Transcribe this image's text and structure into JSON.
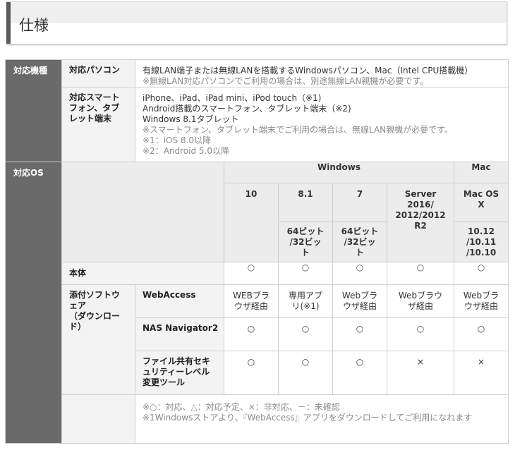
{
  "heading": {
    "title": "仕様"
  },
  "rows": {
    "models": {
      "category": "対応機種",
      "pc": {
        "label": "対応パソコン",
        "text": "有線LAN端子または無線LANを搭載するWindowsパソコン、Mac（Intel CPU搭載機）",
        "note": "※無線LAN対応パソコンでご利用の場合は、別途無線LAN親機が必要です。"
      },
      "mobile": {
        "label_lines": [
          "対応スマート",
          "フォン、タブ",
          "レット端末"
        ],
        "lines": [
          "iPhone、iPad、iPad mini、iPod touch（※1)",
          "Android搭載のスマートフォン、タブレット端末（※2)",
          "Windows 8.1タブレット"
        ],
        "notes": [
          "※スマートフォン、タブレット端末でご利用の場合は、無線LAN親機が必要です。",
          "※1：iOS 8.0以降",
          "※2：Android 5.0以降"
        ]
      }
    },
    "os": {
      "category": "対応OS",
      "groups": {
        "windows": "Windows",
        "mac": "Mac"
      },
      "versions": [
        {
          "lines": [
            "10"
          ]
        },
        {
          "lines": [
            "8.1"
          ]
        },
        {
          "lines": [
            "7"
          ]
        },
        {
          "lines": [
            "Server",
            "2016/",
            "2012/2012",
            "R2"
          ]
        },
        {
          "lines": [
            "Mac OS",
            "X"
          ]
        }
      ],
      "bits": [
        {
          "lines": [
            "64ビット",
            "/32ビッ",
            "ト"
          ]
        },
        {
          "lines": [
            "64ビット",
            "/32ビッ",
            "ト"
          ]
        },
        {
          "lines": [
            "10.12",
            "/10.11",
            "/10.10"
          ]
        }
      ],
      "body": {
        "label": "本体",
        "values": [
          "○",
          "○",
          "○",
          "○",
          "○"
        ]
      },
      "software": {
        "label_lines": [
          "添付ソフトウ",
          "ェア",
          "（ダウンロー",
          "ド）"
        ],
        "webaccess": {
          "label": "WebAccess",
          "values": [
            [
              "WEBブラ",
              "ウザ経由"
            ],
            [
              "専用アプ",
              "リ(※1)"
            ],
            [
              "Webブラ",
              "ウザ経由"
            ],
            [
              "Webブラウ",
              "ザ経由"
            ],
            [
              "Webブラ",
              "ウザ経由"
            ]
          ]
        },
        "nas": {
          "label": "NAS Navigator2",
          "values": [
            "○",
            "○",
            "○",
            "○",
            "○"
          ]
        },
        "security": {
          "label_lines": [
            "ファイル共有セキ",
            "ュリティーレベル",
            "変更ツール"
          ],
          "values": [
            "○",
            "○",
            "○",
            "×",
            "×"
          ]
        }
      },
      "notes": [
        "※○：対応、△：対応予定、×：非対応、－：未確認",
        "※1Windowsストアより、『WebAccess』アプリをダウンロードしてご利用になれます"
      ]
    }
  }
}
